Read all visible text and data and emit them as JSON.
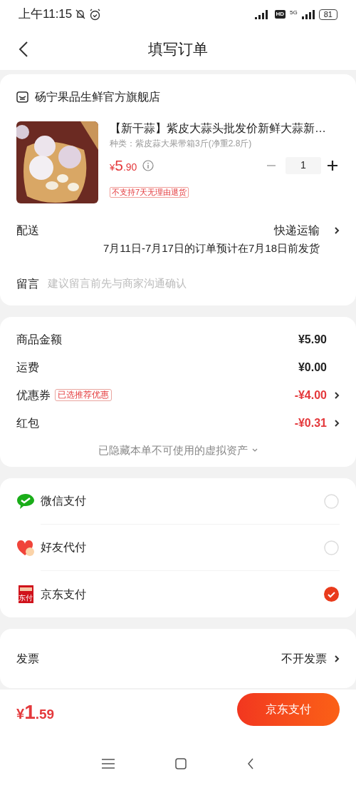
{
  "status_bar": {
    "time": "上午11:15",
    "hd": "HD",
    "network": "5G",
    "battery": "81"
  },
  "header": {
    "title": "填写订单"
  },
  "store": {
    "name": "砀宁果品生鲜官方旗舰店"
  },
  "product": {
    "title": "【新干蒜】紫皮大蒜头批发价新鲜大蒜新…",
    "variant": "种类：紫皮蒜大果带箱3斤(净重2.8斤)",
    "price": {
      "currency": "¥",
      "integer": "5",
      "decimal": ".90"
    },
    "quantity": "1",
    "tag": "不支持7天无理由退货"
  },
  "delivery": {
    "label": "配送",
    "value": "快递运输",
    "note": "7月11日-7月17日的订单预计在7月18日前发货"
  },
  "message": {
    "label": "留言",
    "placeholder": "建议留言前先与商家沟通确认"
  },
  "summary": {
    "rows": [
      {
        "kind": "plain",
        "label": "商品金额",
        "value": "¥5.90"
      },
      {
        "kind": "plain",
        "label": "运费",
        "value": "¥0.00"
      },
      {
        "kind": "discount",
        "label": "优惠券",
        "tag": "已选推荐优惠",
        "value": "-¥4.00"
      },
      {
        "kind": "discount",
        "label": "红包",
        "value": "-¥0.31"
      }
    ],
    "hidden_note": "已隐藏本单不可使用的虚拟资产"
  },
  "payment_methods": [
    {
      "kind": "wechat",
      "label": "微信支付",
      "selected": false
    },
    {
      "kind": "friend",
      "label": "好友代付",
      "selected": false
    },
    {
      "kind": "jd",
      "label": "京东支付",
      "icon_text": "东付",
      "selected": true
    }
  ],
  "invoice": {
    "label": "发票",
    "value": "不开发票"
  },
  "bottom_bar": {
    "total": {
      "currency": "¥",
      "integer": "1",
      "decimal": ".59"
    },
    "pay_button": "京东支付"
  }
}
